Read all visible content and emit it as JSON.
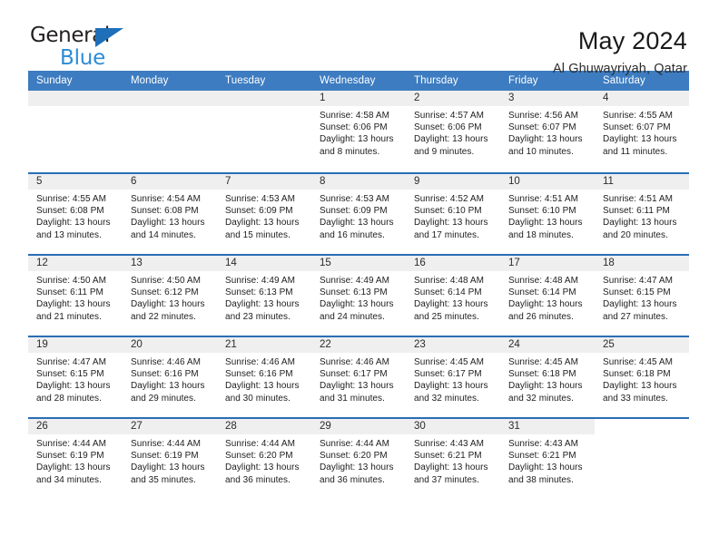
{
  "logo": {
    "word1": "General",
    "word2": "Blue",
    "triangle_color": "#1e6fb8",
    "word2_color": "#2e8bd4"
  },
  "header": {
    "title": "May 2024",
    "subtitle": "Al Ghuwayriyah, Qatar"
  },
  "theme": {
    "header_blue": "#3d7cc0",
    "row_divider_blue": "#2a6db5",
    "daynum_band_gray": "#efeff0"
  },
  "weekdays": [
    "Sunday",
    "Monday",
    "Tuesday",
    "Wednesday",
    "Thursday",
    "Friday",
    "Saturday"
  ],
  "labels": {
    "sunrise_prefix": "Sunrise:",
    "sunset_prefix": "Sunset:",
    "daylight_prefix": "Daylight:"
  },
  "weeks": [
    [
      {
        "day": "",
        "empty": true
      },
      {
        "day": "",
        "empty": true
      },
      {
        "day": "",
        "empty": true
      },
      {
        "day": "1",
        "sunrise": "Sunrise: 4:58 AM",
        "sunset": "Sunset: 6:06 PM",
        "daylight1": "Daylight: 13 hours",
        "daylight2": "and 8 minutes."
      },
      {
        "day": "2",
        "sunrise": "Sunrise: 4:57 AM",
        "sunset": "Sunset: 6:06 PM",
        "daylight1": "Daylight: 13 hours",
        "daylight2": "and 9 minutes."
      },
      {
        "day": "3",
        "sunrise": "Sunrise: 4:56 AM",
        "sunset": "Sunset: 6:07 PM",
        "daylight1": "Daylight: 13 hours",
        "daylight2": "and 10 minutes."
      },
      {
        "day": "4",
        "sunrise": "Sunrise: 4:55 AM",
        "sunset": "Sunset: 6:07 PM",
        "daylight1": "Daylight: 13 hours",
        "daylight2": "and 11 minutes."
      }
    ],
    [
      {
        "day": "5",
        "sunrise": "Sunrise: 4:55 AM",
        "sunset": "Sunset: 6:08 PM",
        "daylight1": "Daylight: 13 hours",
        "daylight2": "and 13 minutes."
      },
      {
        "day": "6",
        "sunrise": "Sunrise: 4:54 AM",
        "sunset": "Sunset: 6:08 PM",
        "daylight1": "Daylight: 13 hours",
        "daylight2": "and 14 minutes."
      },
      {
        "day": "7",
        "sunrise": "Sunrise: 4:53 AM",
        "sunset": "Sunset: 6:09 PM",
        "daylight1": "Daylight: 13 hours",
        "daylight2": "and 15 minutes."
      },
      {
        "day": "8",
        "sunrise": "Sunrise: 4:53 AM",
        "sunset": "Sunset: 6:09 PM",
        "daylight1": "Daylight: 13 hours",
        "daylight2": "and 16 minutes."
      },
      {
        "day": "9",
        "sunrise": "Sunrise: 4:52 AM",
        "sunset": "Sunset: 6:10 PM",
        "daylight1": "Daylight: 13 hours",
        "daylight2": "and 17 minutes."
      },
      {
        "day": "10",
        "sunrise": "Sunrise: 4:51 AM",
        "sunset": "Sunset: 6:10 PM",
        "daylight1": "Daylight: 13 hours",
        "daylight2": "and 18 minutes."
      },
      {
        "day": "11",
        "sunrise": "Sunrise: 4:51 AM",
        "sunset": "Sunset: 6:11 PM",
        "daylight1": "Daylight: 13 hours",
        "daylight2": "and 20 minutes."
      }
    ],
    [
      {
        "day": "12",
        "sunrise": "Sunrise: 4:50 AM",
        "sunset": "Sunset: 6:11 PM",
        "daylight1": "Daylight: 13 hours",
        "daylight2": "and 21 minutes."
      },
      {
        "day": "13",
        "sunrise": "Sunrise: 4:50 AM",
        "sunset": "Sunset: 6:12 PM",
        "daylight1": "Daylight: 13 hours",
        "daylight2": "and 22 minutes."
      },
      {
        "day": "14",
        "sunrise": "Sunrise: 4:49 AM",
        "sunset": "Sunset: 6:13 PM",
        "daylight1": "Daylight: 13 hours",
        "daylight2": "and 23 minutes."
      },
      {
        "day": "15",
        "sunrise": "Sunrise: 4:49 AM",
        "sunset": "Sunset: 6:13 PM",
        "daylight1": "Daylight: 13 hours",
        "daylight2": "and 24 minutes."
      },
      {
        "day": "16",
        "sunrise": "Sunrise: 4:48 AM",
        "sunset": "Sunset: 6:14 PM",
        "daylight1": "Daylight: 13 hours",
        "daylight2": "and 25 minutes."
      },
      {
        "day": "17",
        "sunrise": "Sunrise: 4:48 AM",
        "sunset": "Sunset: 6:14 PM",
        "daylight1": "Daylight: 13 hours",
        "daylight2": "and 26 minutes."
      },
      {
        "day": "18",
        "sunrise": "Sunrise: 4:47 AM",
        "sunset": "Sunset: 6:15 PM",
        "daylight1": "Daylight: 13 hours",
        "daylight2": "and 27 minutes."
      }
    ],
    [
      {
        "day": "19",
        "sunrise": "Sunrise: 4:47 AM",
        "sunset": "Sunset: 6:15 PM",
        "daylight1": "Daylight: 13 hours",
        "daylight2": "and 28 minutes."
      },
      {
        "day": "20",
        "sunrise": "Sunrise: 4:46 AM",
        "sunset": "Sunset: 6:16 PM",
        "daylight1": "Daylight: 13 hours",
        "daylight2": "and 29 minutes."
      },
      {
        "day": "21",
        "sunrise": "Sunrise: 4:46 AM",
        "sunset": "Sunset: 6:16 PM",
        "daylight1": "Daylight: 13 hours",
        "daylight2": "and 30 minutes."
      },
      {
        "day": "22",
        "sunrise": "Sunrise: 4:46 AM",
        "sunset": "Sunset: 6:17 PM",
        "daylight1": "Daylight: 13 hours",
        "daylight2": "and 31 minutes."
      },
      {
        "day": "23",
        "sunrise": "Sunrise: 4:45 AM",
        "sunset": "Sunset: 6:17 PM",
        "daylight1": "Daylight: 13 hours",
        "daylight2": "and 32 minutes."
      },
      {
        "day": "24",
        "sunrise": "Sunrise: 4:45 AM",
        "sunset": "Sunset: 6:18 PM",
        "daylight1": "Daylight: 13 hours",
        "daylight2": "and 32 minutes."
      },
      {
        "day": "25",
        "sunrise": "Sunrise: 4:45 AM",
        "sunset": "Sunset: 6:18 PM",
        "daylight1": "Daylight: 13 hours",
        "daylight2": "and 33 minutes."
      }
    ],
    [
      {
        "day": "26",
        "sunrise": "Sunrise: 4:44 AM",
        "sunset": "Sunset: 6:19 PM",
        "daylight1": "Daylight: 13 hours",
        "daylight2": "and 34 minutes."
      },
      {
        "day": "27",
        "sunrise": "Sunrise: 4:44 AM",
        "sunset": "Sunset: 6:19 PM",
        "daylight1": "Daylight: 13 hours",
        "daylight2": "and 35 minutes."
      },
      {
        "day": "28",
        "sunrise": "Sunrise: 4:44 AM",
        "sunset": "Sunset: 6:20 PM",
        "daylight1": "Daylight: 13 hours",
        "daylight2": "and 36 minutes."
      },
      {
        "day": "29",
        "sunrise": "Sunrise: 4:44 AM",
        "sunset": "Sunset: 6:20 PM",
        "daylight1": "Daylight: 13 hours",
        "daylight2": "and 36 minutes."
      },
      {
        "day": "30",
        "sunrise": "Sunrise: 4:43 AM",
        "sunset": "Sunset: 6:21 PM",
        "daylight1": "Daylight: 13 hours",
        "daylight2": "and 37 minutes."
      },
      {
        "day": "31",
        "sunrise": "Sunrise: 4:43 AM",
        "sunset": "Sunset: 6:21 PM",
        "daylight1": "Daylight: 13 hours",
        "daylight2": "and 38 minutes."
      },
      {
        "day": "",
        "empty": true,
        "no_band": true
      }
    ]
  ]
}
